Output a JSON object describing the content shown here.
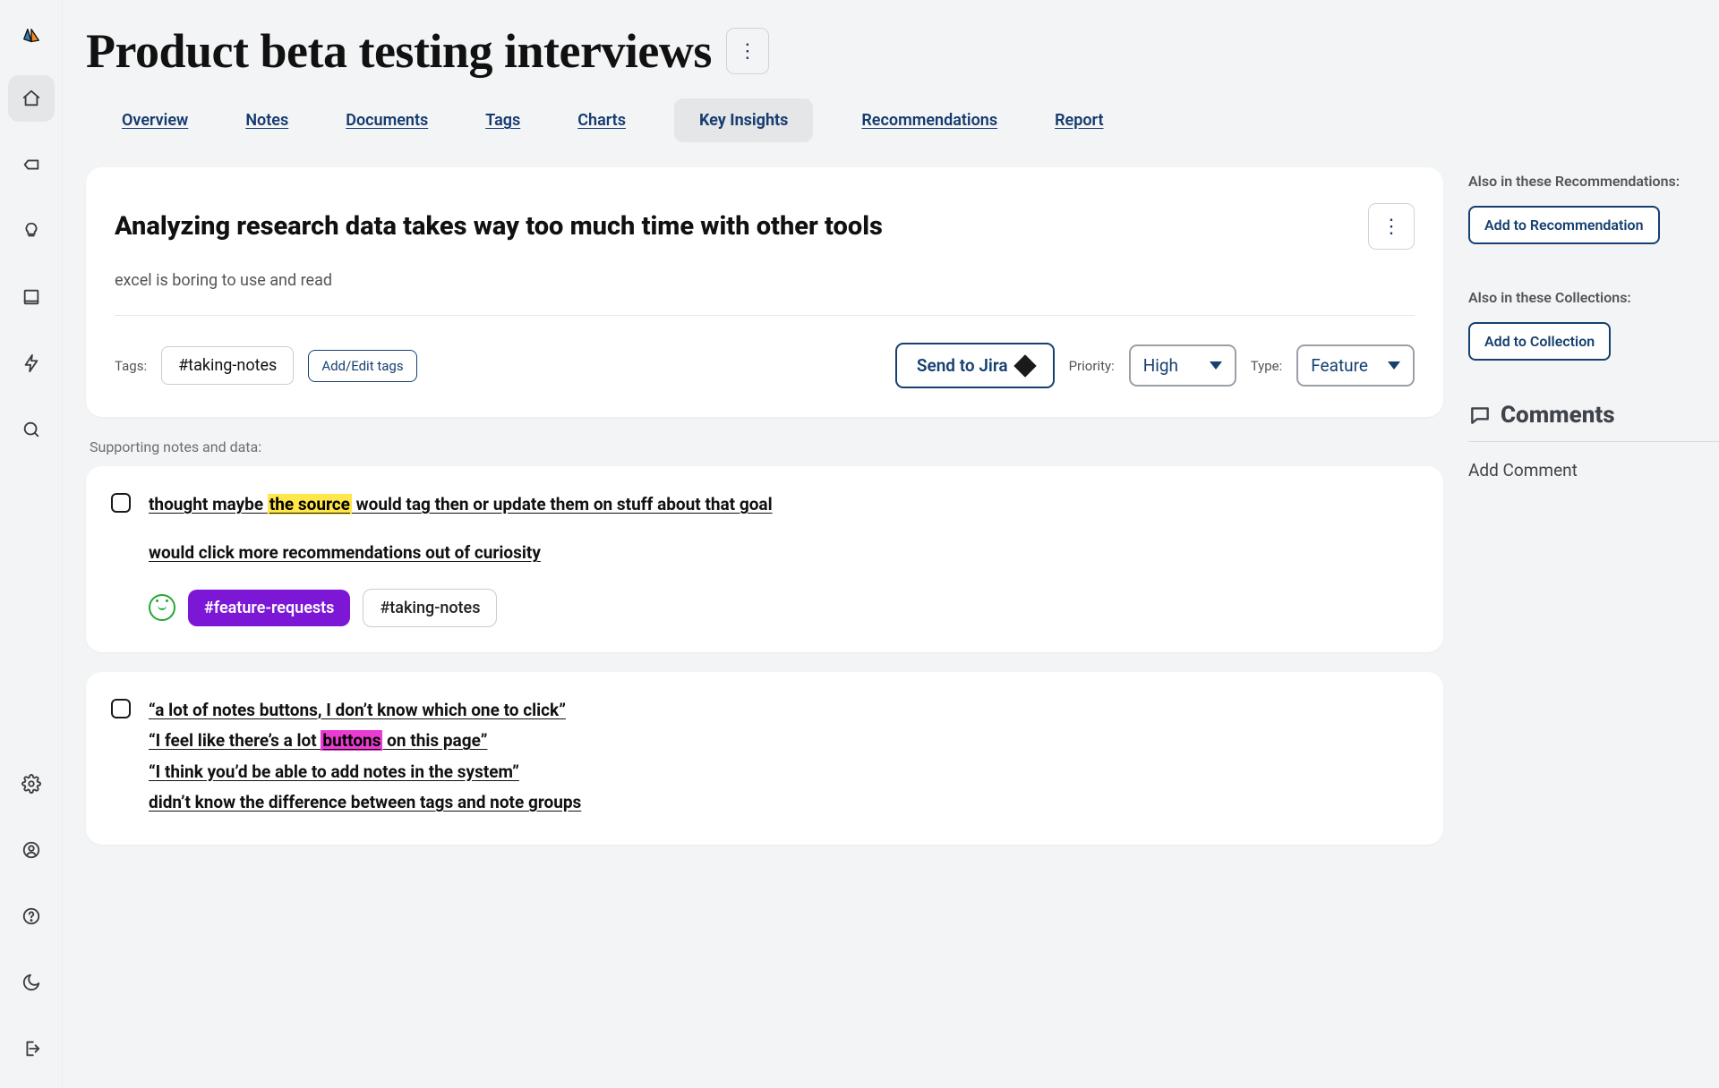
{
  "page": {
    "title": "Product beta testing interviews"
  },
  "tabs": [
    {
      "label": "Overview"
    },
    {
      "label": "Notes"
    },
    {
      "label": "Documents"
    },
    {
      "label": "Tags"
    },
    {
      "label": "Charts"
    },
    {
      "label": "Key Insights",
      "active": true
    },
    {
      "label": "Recommendations"
    },
    {
      "label": "Report"
    }
  ],
  "insight": {
    "title": "Analyzing research data takes way too much time with other tools",
    "subtitle": "excel is boring to use and read",
    "tags_label": "Tags:",
    "tag_primary": "#taking-notes",
    "tag_edit_label": "Add/Edit tags",
    "send_label": "Send to Jira",
    "priority_label": "Priority:",
    "priority_value": "High",
    "type_label": "Type:",
    "type_value": "Feature"
  },
  "right": {
    "also_recs": "Also in these Recommendations:",
    "add_rec": "Add to Recommendation",
    "also_coll": "Also in these Collections:",
    "add_coll": "Add to Collection",
    "comments_title": "Comments",
    "add_comment": "Add Comment"
  },
  "support_label": "Supporting notes and data:",
  "notes": [
    {
      "lines_pre_hl_1": "thought maybe ",
      "hl_1": "the source",
      "lines_post_hl_1": " would tag then or update them on stuff about that goal",
      "line2": "would click more recommendations out of curiosity",
      "chip_feature": "#feature-requests",
      "chip_notes": "#taking-notes"
    },
    {
      "q1": "“a lot of notes buttons, I don’t know which one to click”",
      "q2_pre": "“I feel like there’s a lot ",
      "q2_hl": "buttons",
      "q2_post": " on this page”",
      "q3": "“I think you’d be able to add notes in the system”",
      "q4": "didn’t know the difference between tags and note groups"
    }
  ]
}
